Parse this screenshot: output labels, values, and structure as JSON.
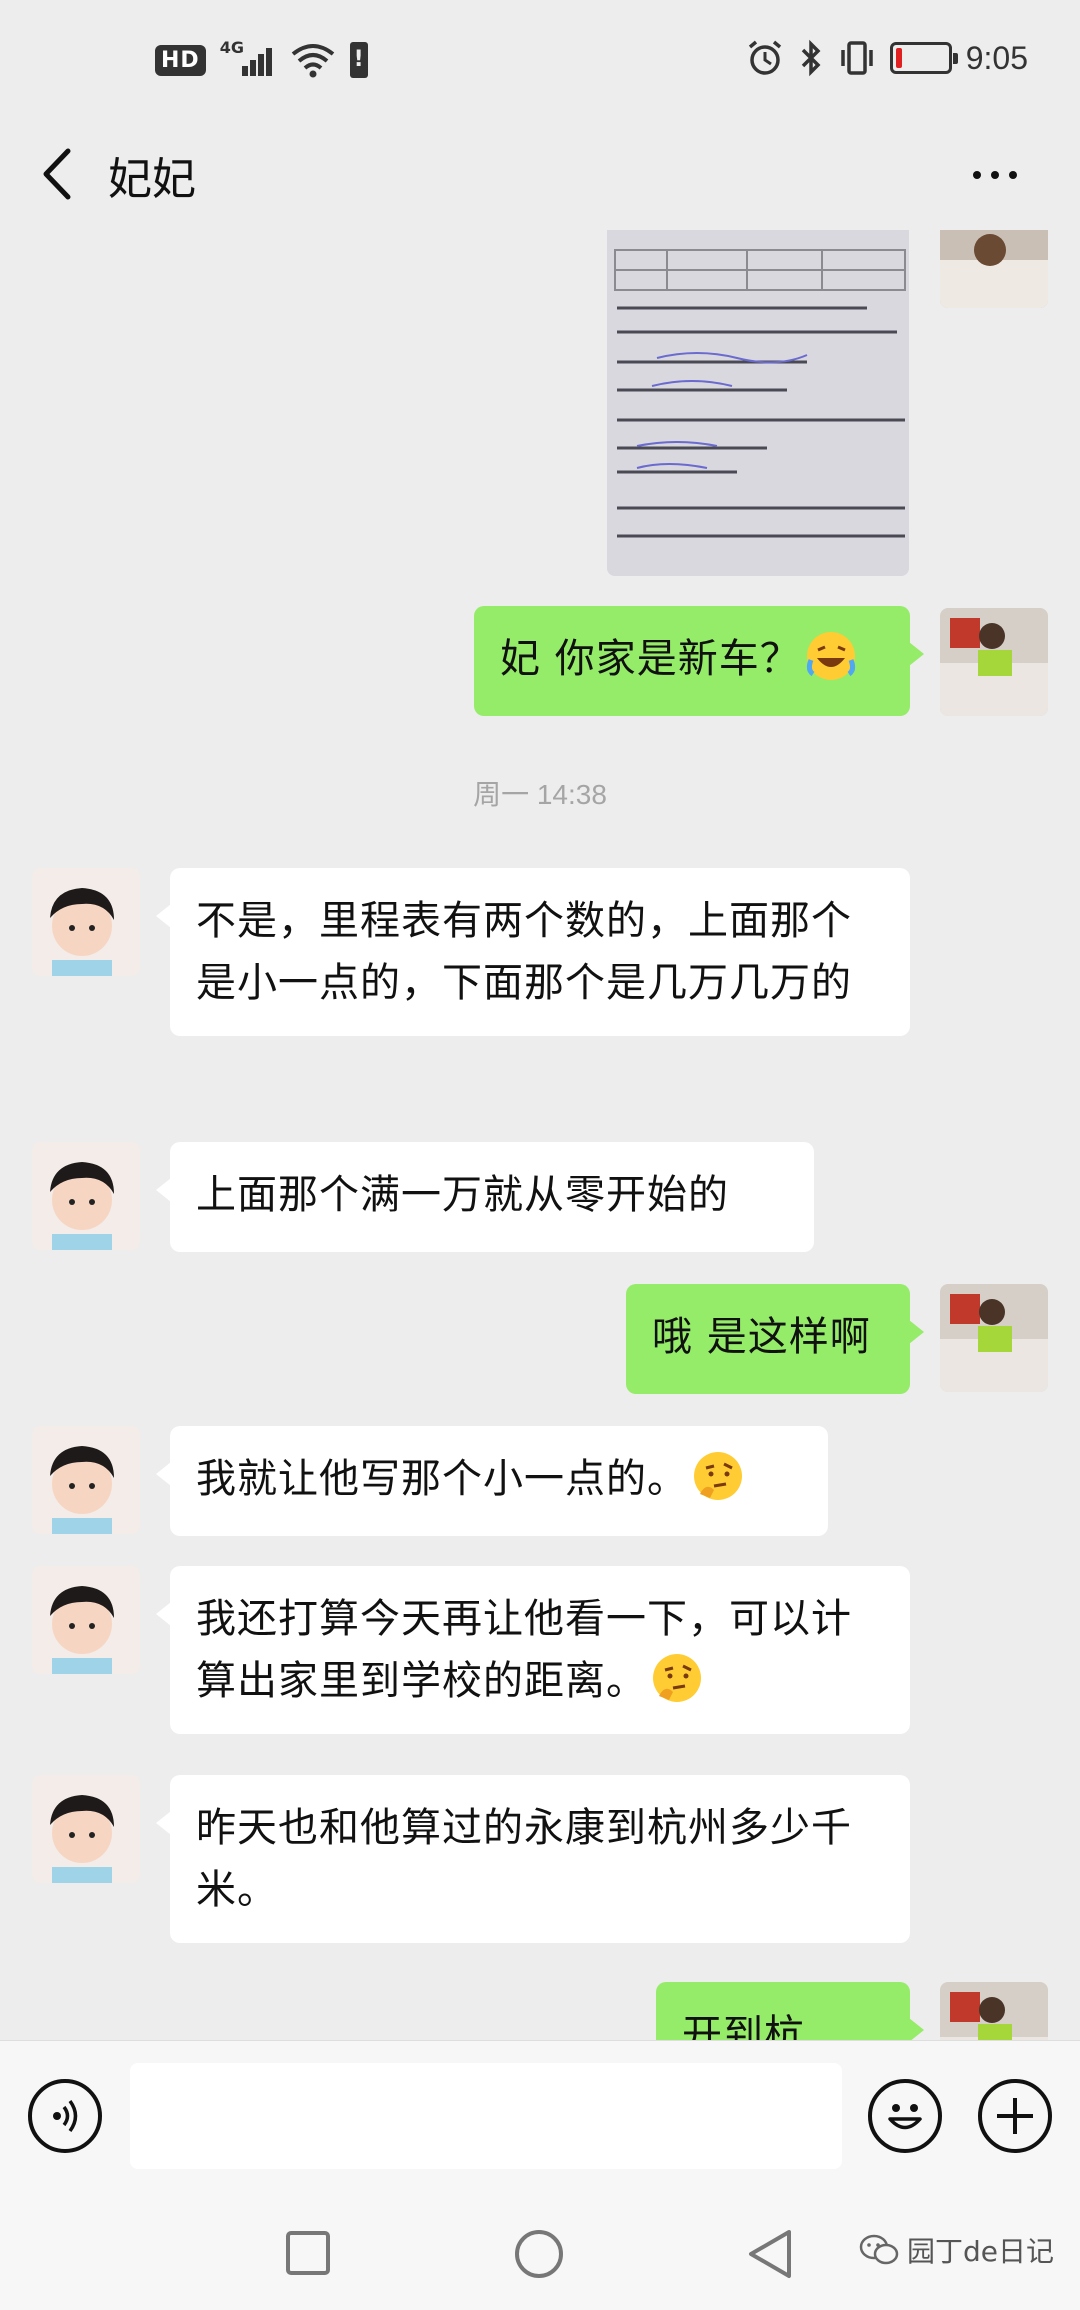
{
  "status_bar": {
    "hd_badge": "HD",
    "network": "4G",
    "warning": "!",
    "battery_level": 0.12,
    "time": "9:05"
  },
  "header": {
    "title": "妃妃",
    "back_icon": "chevron-left-icon",
    "more_icon": "more-dots-icon"
  },
  "messages": [
    {
      "side": "out",
      "type": "image",
      "text": ""
    },
    {
      "side": "out",
      "type": "text",
      "text": "妃 你家是新车？",
      "emoji": "grinning-sweat-emoji"
    },
    {
      "side": "in",
      "type": "text",
      "text": "不是，里程表有两个数的，上面那个是小一点的，下面那个是几万几万的"
    },
    {
      "side": "in",
      "type": "text",
      "text": "上面那个满一万就从零开始的"
    },
    {
      "side": "out",
      "type": "text",
      "text": "哦 是这样啊"
    },
    {
      "side": "in",
      "type": "text",
      "text": "我就让他写那个小一点的。",
      "emoji": "thinking-emoji"
    },
    {
      "side": "in",
      "type": "text",
      "text": "我还打算今天再让他看一下，可以计算出家里到学校的距离。",
      "emoji": "thinking-emoji"
    },
    {
      "side": "in",
      "type": "text",
      "text": " 昨天也和他算过的永康到杭州多少千米。"
    },
    {
      "side": "out",
      "type": "text",
      "text": "开到杭州？"
    }
  ],
  "timestamp": "周一 14:38",
  "input_bar": {
    "voice_icon": "voice-icon",
    "input_value": "",
    "emoji_icon": "smiley-icon",
    "plus_icon": "plus-icon"
  },
  "nav_bar": {
    "icons": [
      "square-icon",
      "circle-icon",
      "triangle-back-icon"
    ]
  },
  "watermark": "园丁de日记",
  "colors": {
    "background": "#ededed",
    "outgoing_bubble": "#95ec69",
    "incoming_bubble": "#ffffff",
    "battery_low": "#e02020"
  }
}
